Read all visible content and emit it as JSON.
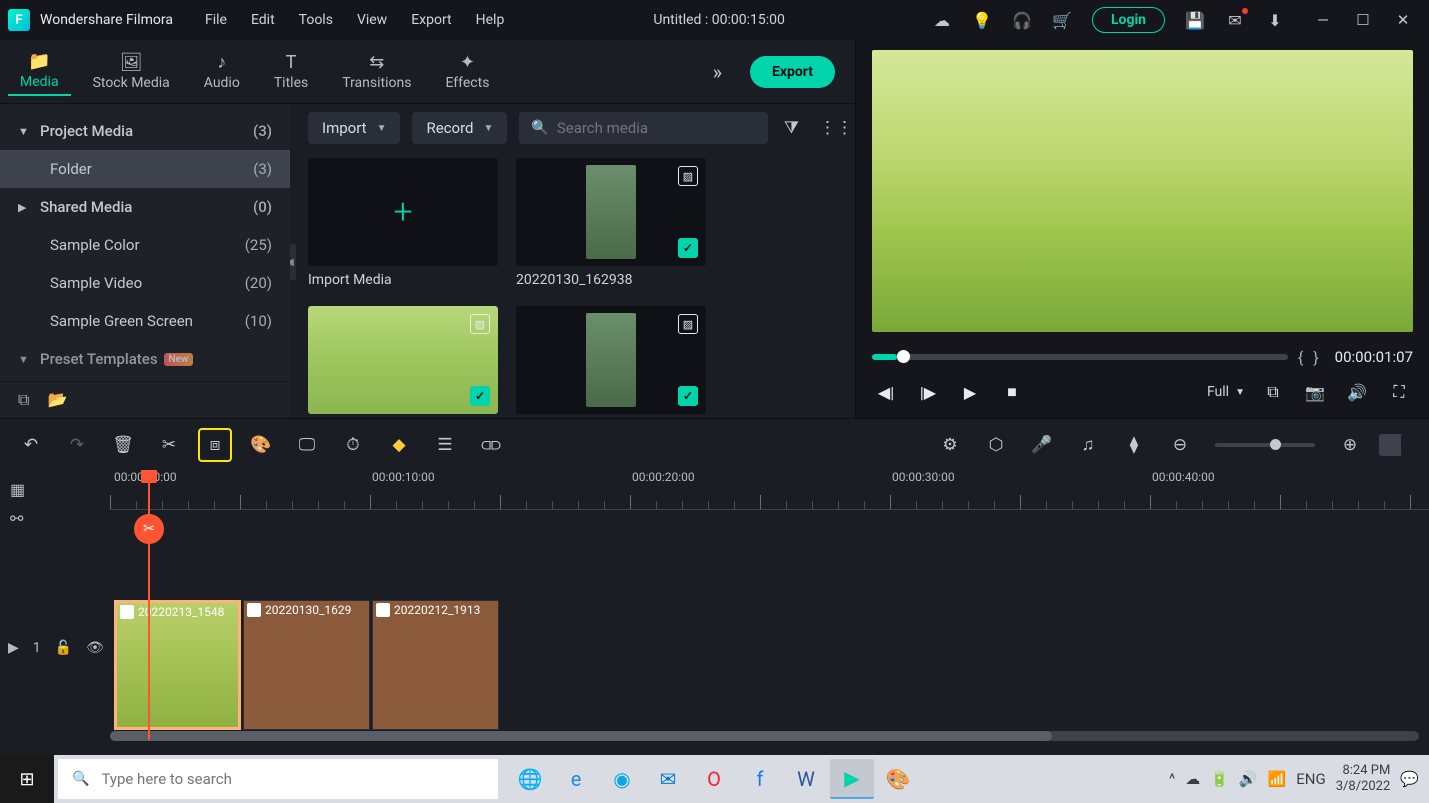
{
  "app": {
    "name": "Wondershare Filmora",
    "project_title": "Untitled : 00:00:15:00"
  },
  "menu": {
    "file": "File",
    "edit": "Edit",
    "tools": "Tools",
    "view": "View",
    "export": "Export",
    "help": "Help"
  },
  "title_actions": {
    "login": "Login"
  },
  "tabs": {
    "media": "Media",
    "stock": "Stock Media",
    "audio": "Audio",
    "titles": "Titles",
    "transitions": "Transitions",
    "effects": "Effects",
    "export_btn": "Export"
  },
  "sidebar": {
    "project_media": {
      "label": "Project Media",
      "count": "(3)"
    },
    "folder": {
      "label": "Folder",
      "count": "(3)"
    },
    "shared": {
      "label": "Shared Media",
      "count": "(0)"
    },
    "sample_color": {
      "label": "Sample Color",
      "count": "(25)"
    },
    "sample_video": {
      "label": "Sample Video",
      "count": "(20)"
    },
    "sample_green": {
      "label": "Sample Green Screen",
      "count": "(10)"
    },
    "preset": {
      "label": "Preset Templates",
      "badge": "New"
    }
  },
  "media_toolbar": {
    "import": "Import",
    "record": "Record",
    "search_placeholder": "Search media"
  },
  "media_items": {
    "import_label": "Import Media",
    "item1_label": "20220130_162938"
  },
  "preview": {
    "timecode": "00:00:01:07",
    "quality": "Full"
  },
  "ruler": {
    "t0": "00:00:00:00",
    "t10": "00:00:10:00",
    "t20": "00:00:20:00",
    "t30": "00:00:30:00",
    "t40": "00:00:40:00"
  },
  "clips": {
    "c1": "20220213_1548",
    "c2": "20220130_1629",
    "c3": "20220212_1913"
  },
  "track": {
    "label": "1"
  },
  "taskbar": {
    "search_placeholder": "Type here to search",
    "lang": "ENG",
    "time": "8:24 PM",
    "date": "3/8/2022"
  }
}
